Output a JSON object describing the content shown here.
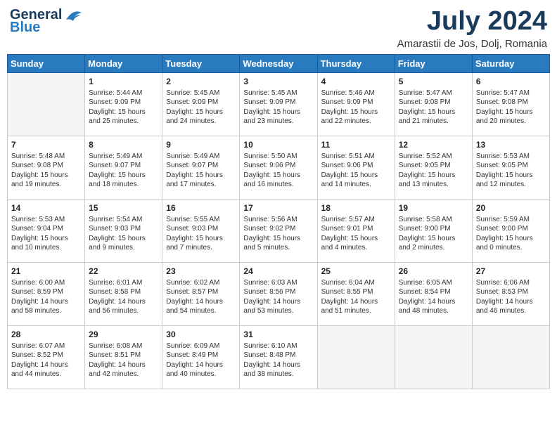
{
  "header": {
    "logo_line1": "General",
    "logo_line2": "Blue",
    "month_title": "July 2024",
    "location": "Amarastii de Jos, Dolj, Romania"
  },
  "days_of_week": [
    "Sunday",
    "Monday",
    "Tuesday",
    "Wednesday",
    "Thursday",
    "Friday",
    "Saturday"
  ],
  "weeks": [
    [
      {
        "day": "",
        "info": ""
      },
      {
        "day": "1",
        "info": "Sunrise: 5:44 AM\nSunset: 9:09 PM\nDaylight: 15 hours\nand 25 minutes."
      },
      {
        "day": "2",
        "info": "Sunrise: 5:45 AM\nSunset: 9:09 PM\nDaylight: 15 hours\nand 24 minutes."
      },
      {
        "day": "3",
        "info": "Sunrise: 5:45 AM\nSunset: 9:09 PM\nDaylight: 15 hours\nand 23 minutes."
      },
      {
        "day": "4",
        "info": "Sunrise: 5:46 AM\nSunset: 9:09 PM\nDaylight: 15 hours\nand 22 minutes."
      },
      {
        "day": "5",
        "info": "Sunrise: 5:47 AM\nSunset: 9:08 PM\nDaylight: 15 hours\nand 21 minutes."
      },
      {
        "day": "6",
        "info": "Sunrise: 5:47 AM\nSunset: 9:08 PM\nDaylight: 15 hours\nand 20 minutes."
      }
    ],
    [
      {
        "day": "7",
        "info": "Sunrise: 5:48 AM\nSunset: 9:08 PM\nDaylight: 15 hours\nand 19 minutes."
      },
      {
        "day": "8",
        "info": "Sunrise: 5:49 AM\nSunset: 9:07 PM\nDaylight: 15 hours\nand 18 minutes."
      },
      {
        "day": "9",
        "info": "Sunrise: 5:49 AM\nSunset: 9:07 PM\nDaylight: 15 hours\nand 17 minutes."
      },
      {
        "day": "10",
        "info": "Sunrise: 5:50 AM\nSunset: 9:06 PM\nDaylight: 15 hours\nand 16 minutes."
      },
      {
        "day": "11",
        "info": "Sunrise: 5:51 AM\nSunset: 9:06 PM\nDaylight: 15 hours\nand 14 minutes."
      },
      {
        "day": "12",
        "info": "Sunrise: 5:52 AM\nSunset: 9:05 PM\nDaylight: 15 hours\nand 13 minutes."
      },
      {
        "day": "13",
        "info": "Sunrise: 5:53 AM\nSunset: 9:05 PM\nDaylight: 15 hours\nand 12 minutes."
      }
    ],
    [
      {
        "day": "14",
        "info": "Sunrise: 5:53 AM\nSunset: 9:04 PM\nDaylight: 15 hours\nand 10 minutes."
      },
      {
        "day": "15",
        "info": "Sunrise: 5:54 AM\nSunset: 9:03 PM\nDaylight: 15 hours\nand 9 minutes."
      },
      {
        "day": "16",
        "info": "Sunrise: 5:55 AM\nSunset: 9:03 PM\nDaylight: 15 hours\nand 7 minutes."
      },
      {
        "day": "17",
        "info": "Sunrise: 5:56 AM\nSunset: 9:02 PM\nDaylight: 15 hours\nand 5 minutes."
      },
      {
        "day": "18",
        "info": "Sunrise: 5:57 AM\nSunset: 9:01 PM\nDaylight: 15 hours\nand 4 minutes."
      },
      {
        "day": "19",
        "info": "Sunrise: 5:58 AM\nSunset: 9:00 PM\nDaylight: 15 hours\nand 2 minutes."
      },
      {
        "day": "20",
        "info": "Sunrise: 5:59 AM\nSunset: 9:00 PM\nDaylight: 15 hours\nand 0 minutes."
      }
    ],
    [
      {
        "day": "21",
        "info": "Sunrise: 6:00 AM\nSunset: 8:59 PM\nDaylight: 14 hours\nand 58 minutes."
      },
      {
        "day": "22",
        "info": "Sunrise: 6:01 AM\nSunset: 8:58 PM\nDaylight: 14 hours\nand 56 minutes."
      },
      {
        "day": "23",
        "info": "Sunrise: 6:02 AM\nSunset: 8:57 PM\nDaylight: 14 hours\nand 54 minutes."
      },
      {
        "day": "24",
        "info": "Sunrise: 6:03 AM\nSunset: 8:56 PM\nDaylight: 14 hours\nand 53 minutes."
      },
      {
        "day": "25",
        "info": "Sunrise: 6:04 AM\nSunset: 8:55 PM\nDaylight: 14 hours\nand 51 minutes."
      },
      {
        "day": "26",
        "info": "Sunrise: 6:05 AM\nSunset: 8:54 PM\nDaylight: 14 hours\nand 48 minutes."
      },
      {
        "day": "27",
        "info": "Sunrise: 6:06 AM\nSunset: 8:53 PM\nDaylight: 14 hours\nand 46 minutes."
      }
    ],
    [
      {
        "day": "28",
        "info": "Sunrise: 6:07 AM\nSunset: 8:52 PM\nDaylight: 14 hours\nand 44 minutes."
      },
      {
        "day": "29",
        "info": "Sunrise: 6:08 AM\nSunset: 8:51 PM\nDaylight: 14 hours\nand 42 minutes."
      },
      {
        "day": "30",
        "info": "Sunrise: 6:09 AM\nSunset: 8:49 PM\nDaylight: 14 hours\nand 40 minutes."
      },
      {
        "day": "31",
        "info": "Sunrise: 6:10 AM\nSunset: 8:48 PM\nDaylight: 14 hours\nand 38 minutes."
      },
      {
        "day": "",
        "info": ""
      },
      {
        "day": "",
        "info": ""
      },
      {
        "day": "",
        "info": ""
      }
    ]
  ]
}
